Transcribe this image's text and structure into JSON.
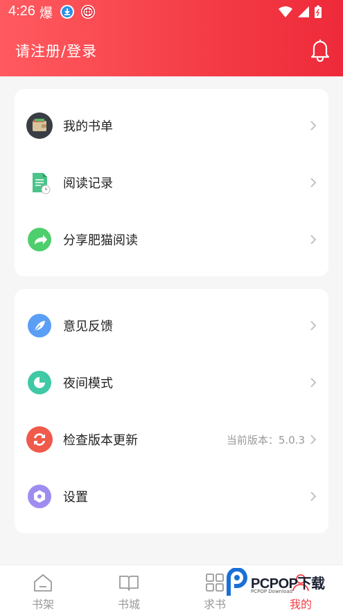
{
  "status_bar": {
    "time": "4:26",
    "app_glyph": "爆"
  },
  "header": {
    "title": "请注册/登录"
  },
  "section1": [
    {
      "label": "我的书单",
      "icon": "wallet-icon"
    },
    {
      "label": "阅读记录",
      "icon": "document-clock-icon"
    },
    {
      "label": "分享肥猫阅读",
      "icon": "share-arrow-icon"
    }
  ],
  "section2": [
    {
      "label": "意见反馈",
      "icon": "feather-icon"
    },
    {
      "label": "夜间模式",
      "icon": "moon-icon"
    },
    {
      "label": "检查版本更新",
      "icon": "refresh-icon",
      "value": "当前版本：5.0.3"
    },
    {
      "label": "设置",
      "icon": "hexagon-settings-icon"
    }
  ],
  "tabbar": [
    {
      "label": "书架",
      "icon": "home-icon",
      "active": false
    },
    {
      "label": "书城",
      "icon": "book-icon",
      "active": false
    },
    {
      "label": "求书",
      "icon": "grid-icon",
      "active": false
    },
    {
      "label": "我的",
      "icon": "person-icon",
      "active": true
    }
  ],
  "watermark": {
    "text": "PCPOP下载",
    "sub": "PCPOP Download"
  },
  "colors": {
    "accent": "#f43c46",
    "header_start": "#ff5a5f",
    "header_end": "#ee2a3a"
  }
}
